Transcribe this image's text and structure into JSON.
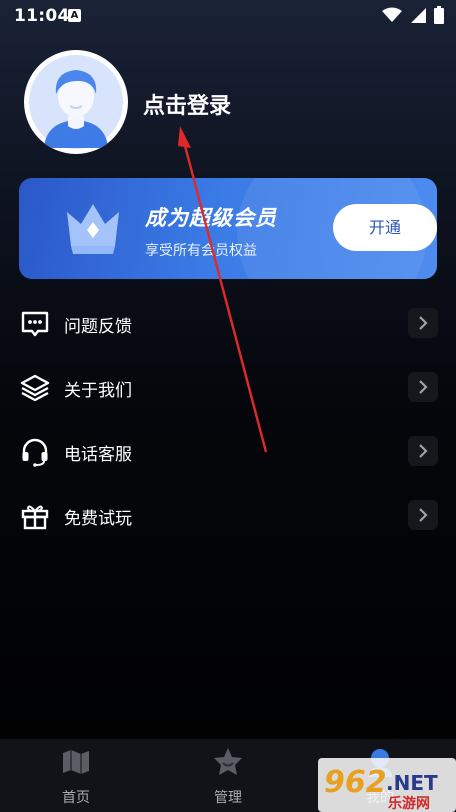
{
  "status_bar": {
    "time": "11:04",
    "notification_letter": "A"
  },
  "profile": {
    "login_text": "点击登录"
  },
  "vip": {
    "title": "成为超级会员",
    "subtitle": "享受所有会员权益",
    "button_label": "开通"
  },
  "menu": {
    "items": [
      {
        "label": "问题反馈",
        "icon": "chat-dots-icon"
      },
      {
        "label": "关于我们",
        "icon": "layers-icon"
      },
      {
        "label": "电话客服",
        "icon": "headset-icon"
      },
      {
        "label": "免费试玩",
        "icon": "gift-icon"
      }
    ]
  },
  "nav": {
    "items": [
      {
        "label": "首页",
        "icon": "map-icon"
      },
      {
        "label": "管理",
        "icon": "star-smile-icon"
      },
      {
        "label": "我的",
        "icon": "user-icon"
      }
    ]
  },
  "watermark": {
    "number": "962",
    "suffix": ".NET",
    "site": "乐游网"
  },
  "colors": {
    "accent_blue": "#3a7ae5",
    "annotation_red": "#e02a2a",
    "background": "#000000"
  }
}
